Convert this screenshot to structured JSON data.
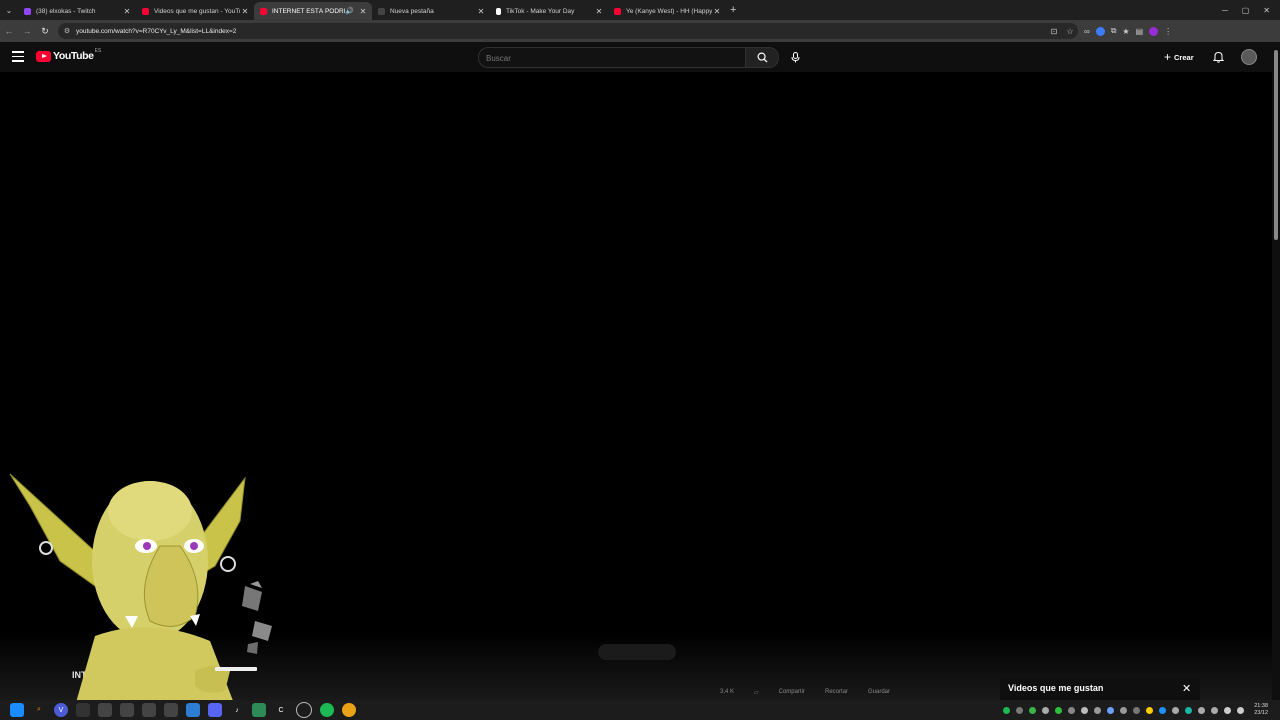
{
  "browser": {
    "tabs": [
      {
        "title": "(38) elxokas - Twitch",
        "favicon_color": "#9146ff",
        "active": false,
        "audio": false
      },
      {
        "title": "Videos que me gustan - YouTube",
        "favicon_color": "#ff0033",
        "active": false,
        "audio": false
      },
      {
        "title": "INTERNET ESTÁ PODRIDO",
        "favicon_color": "#ff0033",
        "active": true,
        "audio": true
      },
      {
        "title": "Nueva pestaña",
        "favicon_color": "#444444",
        "active": false,
        "audio": false
      },
      {
        "title": "TikTok - Make Your Day",
        "favicon_color": "#ffffff",
        "active": false,
        "audio": false
      },
      {
        "title": "Ye (Kanye West) - HH (Happy Holidays)",
        "favicon_color": "#ff0033",
        "active": false,
        "audio": false
      }
    ],
    "url": "youtube.com/watch?v=R70CYv_Ly_M&list=LL&index=2"
  },
  "youtube": {
    "logo_text": "YouTube",
    "country_code": "ES",
    "search_placeholder": "Buscar",
    "create_label": "Crear",
    "video_title_fragment": "INTER",
    "action_chips": [
      "3,4 K",
      "",
      "Compartir",
      "Recortar",
      "Guardar"
    ],
    "playlist_panel_title": "Videos que me gustan"
  },
  "taskbar": {
    "time": "21:38",
    "date": "23/12"
  },
  "colors": {
    "brand_red": "#ff0033",
    "background": "#000000",
    "header": "#0f0f0f"
  }
}
